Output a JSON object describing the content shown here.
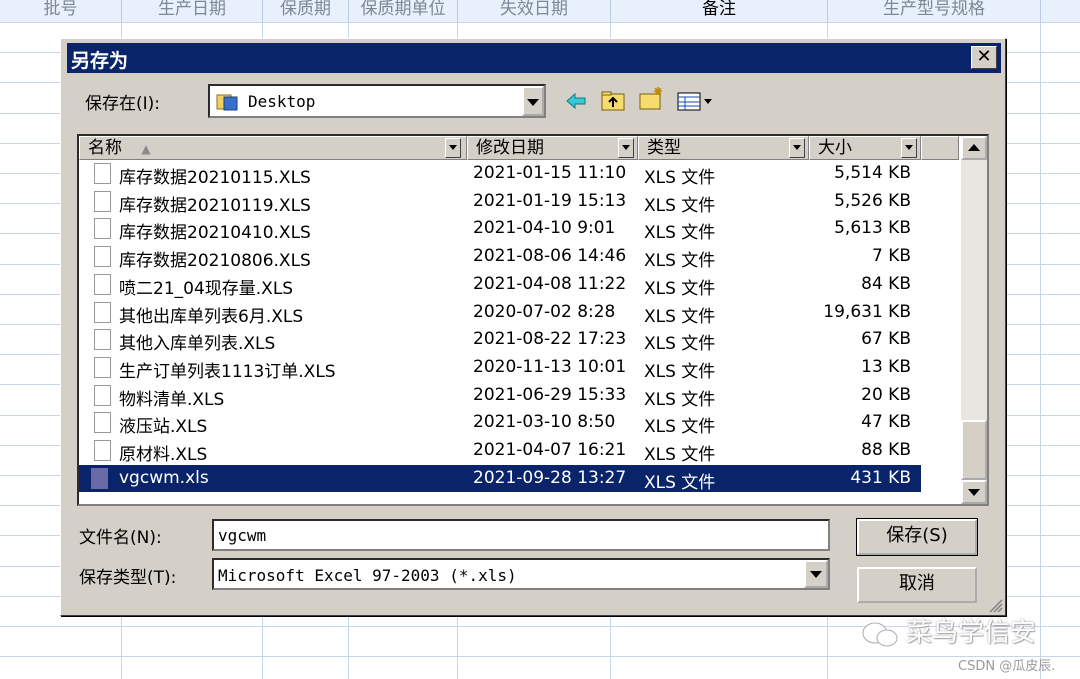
{
  "sheet": {
    "headers": [
      "批号",
      "生产日期",
      "保质期",
      "保质期单位",
      "失效日期",
      "备注",
      "生产型号规格"
    ]
  },
  "dialog": {
    "title": "另存为",
    "close_label": "✕",
    "location_label": "保存在(I):",
    "location_value": "Desktop",
    "columns": {
      "name": "名称",
      "date": "修改日期",
      "type": "类型",
      "size": "大小"
    },
    "files": [
      {
        "name": "库存数据20210115.XLS",
        "date": "2021-01-15 11:10",
        "type": "XLS 文件",
        "size": "5,514 KB"
      },
      {
        "name": "库存数据20210119.XLS",
        "date": "2021-01-19 15:13",
        "type": "XLS 文件",
        "size": "5,526 KB"
      },
      {
        "name": "库存数据20210410.XLS",
        "date": "2021-04-10 9:01",
        "type": "XLS 文件",
        "size": "5,613 KB"
      },
      {
        "name": "库存数据20210806.XLS",
        "date": "2021-08-06 14:46",
        "type": "XLS 文件",
        "size": "7 KB"
      },
      {
        "name": "喷二21_04现存量.XLS",
        "date": "2021-04-08 11:22",
        "type": "XLS 文件",
        "size": "84 KB"
      },
      {
        "name": "其他出库单列表6月.XLS",
        "date": "2020-07-02 8:28",
        "type": "XLS 文件",
        "size": "19,631 KB"
      },
      {
        "name": "其他入库单列表.XLS",
        "date": "2021-08-22 17:23",
        "type": "XLS 文件",
        "size": "67 KB"
      },
      {
        "name": "生产订单列表1113订单.XLS",
        "date": "2020-11-13 10:01",
        "type": "XLS 文件",
        "size": "13 KB"
      },
      {
        "name": "物料清单.XLS",
        "date": "2021-06-29 15:33",
        "type": "XLS 文件",
        "size": "20 KB"
      },
      {
        "name": "液压站.XLS",
        "date": "2021-03-10 8:50",
        "type": "XLS 文件",
        "size": "47 KB"
      },
      {
        "name": "原材料.XLS",
        "date": "2021-04-07 16:21",
        "type": "XLS 文件",
        "size": "88 KB"
      },
      {
        "name": "vgcwm.xls",
        "date": "2021-09-28 13:27",
        "type": "XLS 文件",
        "size": "431 KB",
        "selected": true
      }
    ],
    "filename_label": "文件名(N):",
    "filename_value": "vgcwm",
    "filetype_label": "保存类型(T):",
    "filetype_value": "Microsoft Excel 97-2003 (*.xls)",
    "save_label": "保存(S)",
    "cancel_label": "取消"
  },
  "watermark": {
    "text": "菜鸟学信安",
    "credit": "CSDN @瓜皮辰."
  },
  "colors": {
    "titlebar": "#0a246a",
    "dialog_bg": "#d4d0c8",
    "selection": "#0a246a"
  },
  "icons": [
    "folder-icon",
    "back-arrow-icon",
    "up-folder-icon",
    "new-folder-icon",
    "view-menu-icon",
    "file-icon",
    "resize-grip-icon",
    "wechat-icon"
  ]
}
